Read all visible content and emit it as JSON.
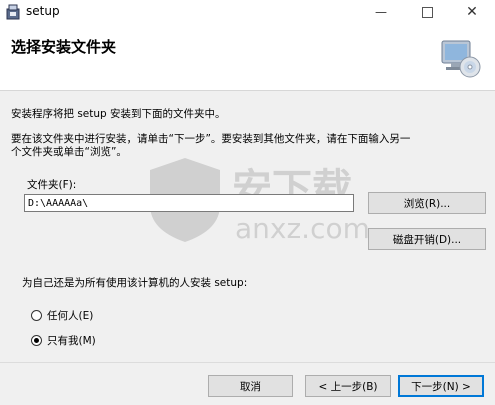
{
  "window": {
    "title": "setup"
  },
  "header": {
    "title": "选择安装文件夹"
  },
  "body": {
    "line1": "安装程序将把 setup 安装到下面的文件夹中。",
    "line2a": "要在该文件夹中进行安装，请单击“下一步”。要安装到其他文件夹，请在下面输入另一",
    "line2b": "个文件夹或单击“浏览”。"
  },
  "folder": {
    "label": "文件夹(F):",
    "value": "D:\\AAAAAa\\"
  },
  "buttons": {
    "browse": "浏览(R)...",
    "disk_cost": "磁盘开销(D)...",
    "cancel": "取消",
    "back": "< 上一步(B)",
    "next": "下一步(N) >"
  },
  "install_for": {
    "question": "为自己还是为所有使用该计算机的人安装 setup:",
    "options": [
      {
        "label": "任何人(E)",
        "selected": false
      },
      {
        "label": "只有我(M)",
        "selected": true
      }
    ]
  },
  "watermark": {
    "brand": "安下载",
    "domain": "anxz.com"
  },
  "colors": {
    "accent": "#0078d7",
    "window_bg": "#f0f0f0",
    "header_bg": "#ffffff"
  }
}
